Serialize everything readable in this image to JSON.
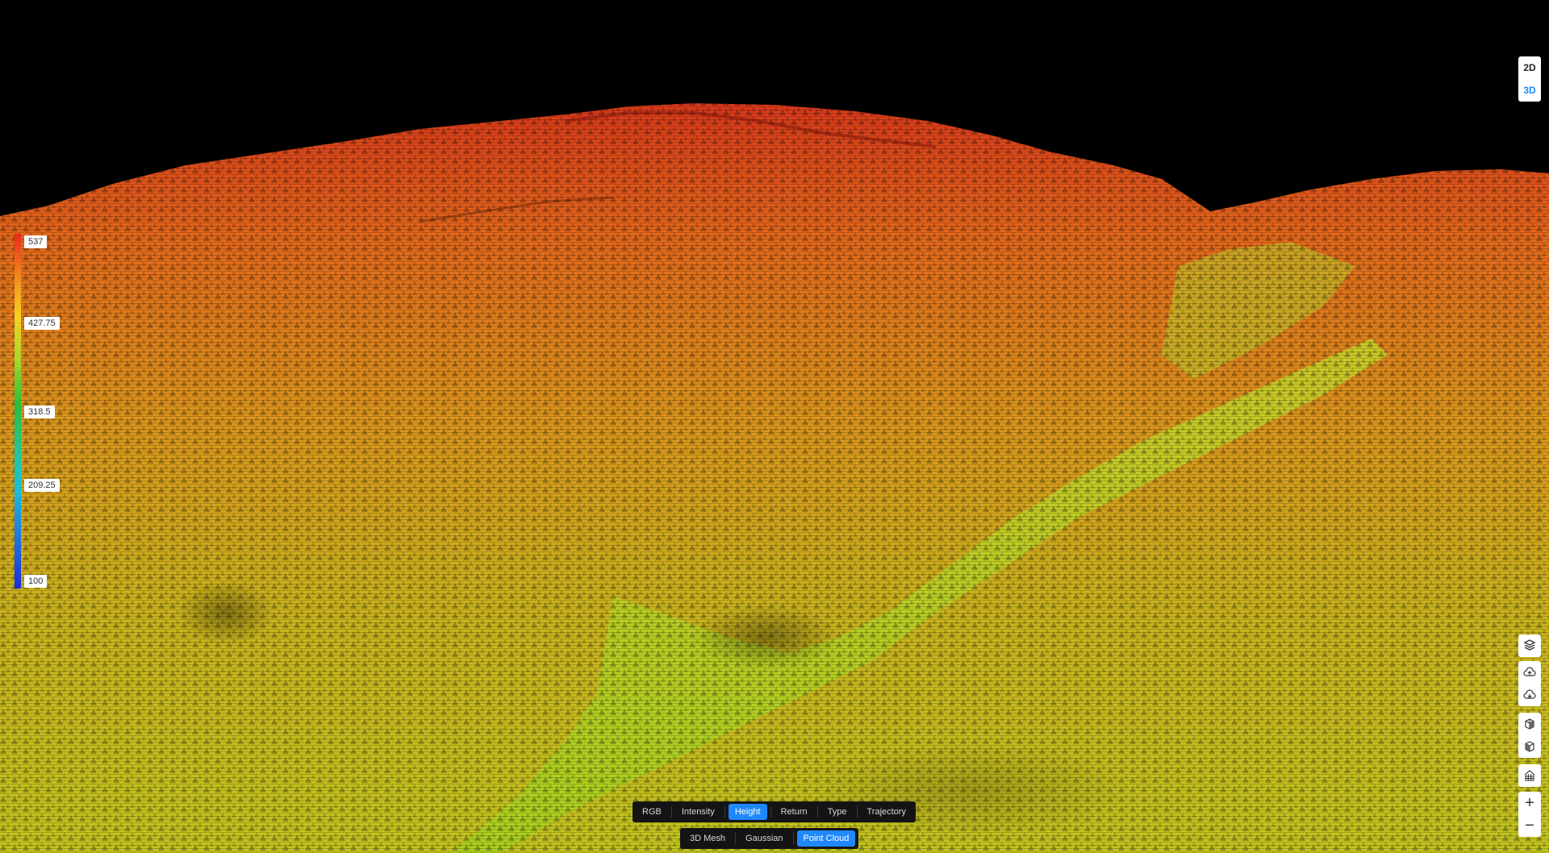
{
  "view_toggle": {
    "options": [
      "2D",
      "3D"
    ],
    "active": "3D"
  },
  "legend": {
    "ticks": [
      {
        "label": "537",
        "fraction": 0.0
      },
      {
        "label": "427.75",
        "fraction": 0.23
      },
      {
        "label": "318.5",
        "fraction": 0.49
      },
      {
        "label": "209.25",
        "fraction": 0.7
      },
      {
        "label": "100",
        "fraction": 0.98
      }
    ],
    "colors": [
      "#e8281c",
      "#f28a1e",
      "#f7d11f",
      "#a6d62b",
      "#27c03a",
      "#1ec7a0",
      "#15c2de",
      "#1e7fe0",
      "#1b2ee0"
    ]
  },
  "color_modes": {
    "tabs": [
      "RGB",
      "Intensity",
      "Height",
      "Return",
      "Type",
      "Trajectory"
    ],
    "active": "Height"
  },
  "render_modes": {
    "tabs": [
      "3D Mesh",
      "Gaussian",
      "Point Cloud"
    ],
    "active": "Point Cloud"
  },
  "tools": {
    "icons": [
      "layers-cube-icon",
      "cloud-upload-icon",
      "cloud-download-icon",
      "box-front-icon",
      "box-side-icon",
      "building-icon"
    ],
    "zoom_in": "+",
    "zoom_out": "−"
  },
  "colors": {
    "accent": "#1e88ff",
    "background": "#000000",
    "terrain_high": "#d8381a",
    "terrain_mid": "#e0a21c",
    "terrain_low": "#bcd41f"
  }
}
